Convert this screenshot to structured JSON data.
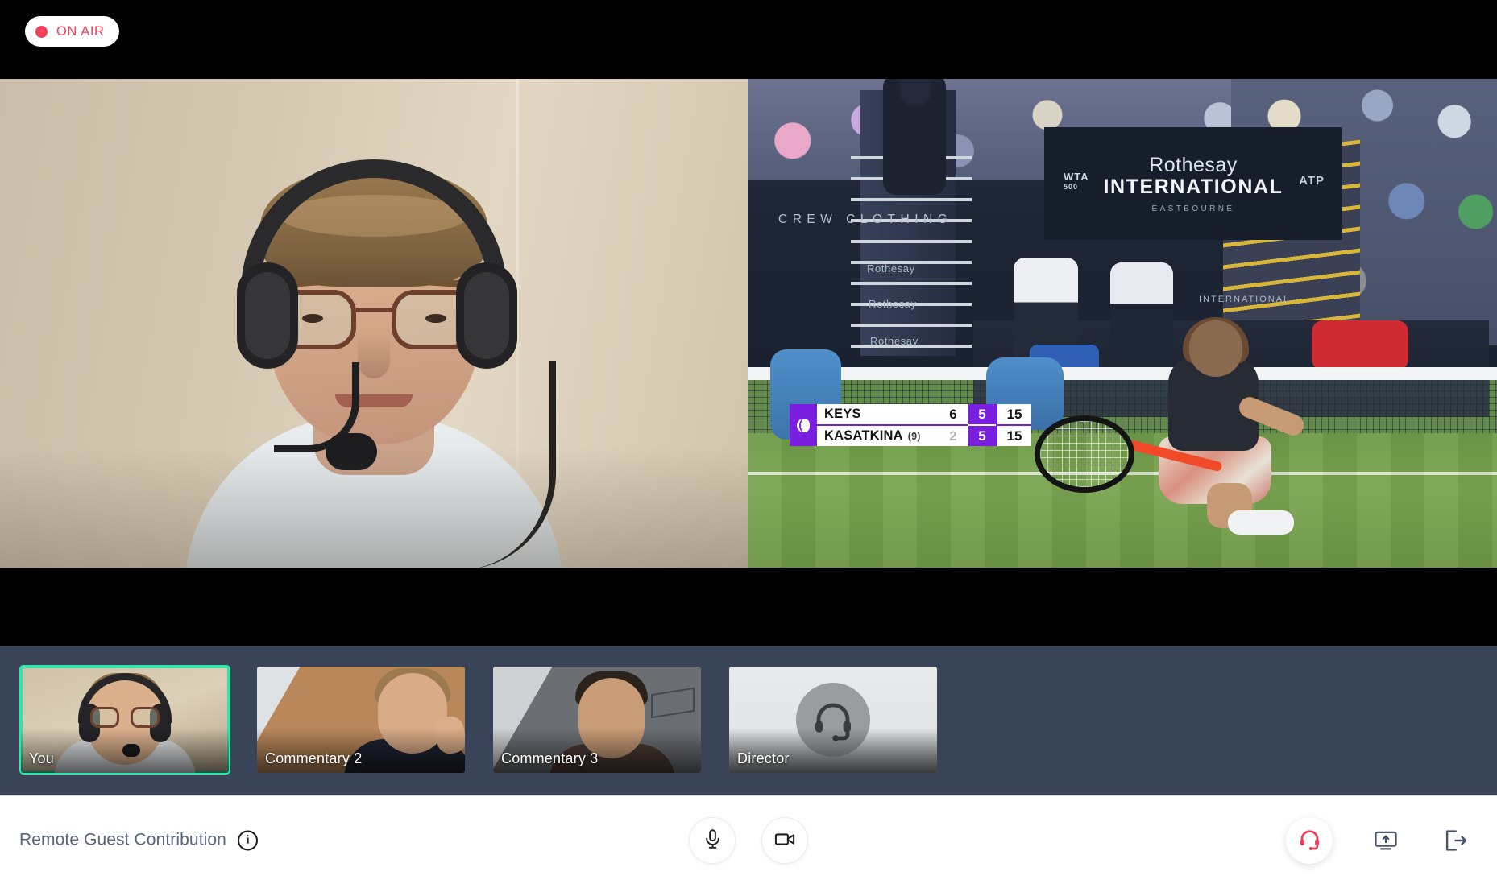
{
  "topbar": {
    "on_air_label": "ON AIR",
    "on_air_color": "#f0405c"
  },
  "stage": {
    "left_video": {
      "name": "local-presenter-video",
      "description": "Presenter wearing headset with boom microphone"
    },
    "right_video": {
      "name": "programme-output-video",
      "description": "Live tennis broadcast feed",
      "signage": {
        "brand": "Rothesay",
        "event": "INTERNATIONAL",
        "city": "EASTBOURNE",
        "wta": "WTA",
        "wta_tier": "500",
        "atp": "ATP",
        "crew_text": "CREW CLOTHING",
        "rothesay_boards": [
          "Rothesay",
          "Rothesay",
          "Rothesay",
          "INTERNATIONAL"
        ]
      },
      "scoreboard": {
        "accent_color": "#7a1fe0",
        "rows": [
          {
            "player": "KEYS",
            "seed": "",
            "sets": "6",
            "games": "5",
            "points": "15"
          },
          {
            "player": "KASATKINA",
            "seed": "(9)",
            "sets": "2",
            "games": "5",
            "points": "15"
          }
        ]
      }
    }
  },
  "filmstrip": {
    "background_color": "#394459",
    "active_border_color": "#2fe6a8",
    "tiles": [
      {
        "label": "You",
        "active": true,
        "kind": "video"
      },
      {
        "label": "Commentary 2",
        "active": false,
        "kind": "video"
      },
      {
        "label": "Commentary 3",
        "active": false,
        "kind": "video"
      },
      {
        "label": "Director",
        "active": false,
        "kind": "avatar",
        "avatar_icon": "headset-icon"
      }
    ]
  },
  "bottombar": {
    "title": "Remote Guest Contribution",
    "info_icon": "info-icon",
    "info_glyph": "i",
    "controls": {
      "mic": {
        "icon": "microphone-icon",
        "label": "Microphone",
        "muted": false
      },
      "camera": {
        "icon": "camera-icon",
        "label": "Camera",
        "off": false
      }
    },
    "right_controls": {
      "talkback": {
        "icon": "headset-icon",
        "label": "Talkback",
        "active": true,
        "color": "#ec3f5b"
      },
      "share_screen": {
        "icon": "screen-share-icon",
        "label": "Share screen",
        "active": false
      },
      "leave": {
        "icon": "leave-icon",
        "label": "Leave",
        "active": false
      }
    }
  }
}
